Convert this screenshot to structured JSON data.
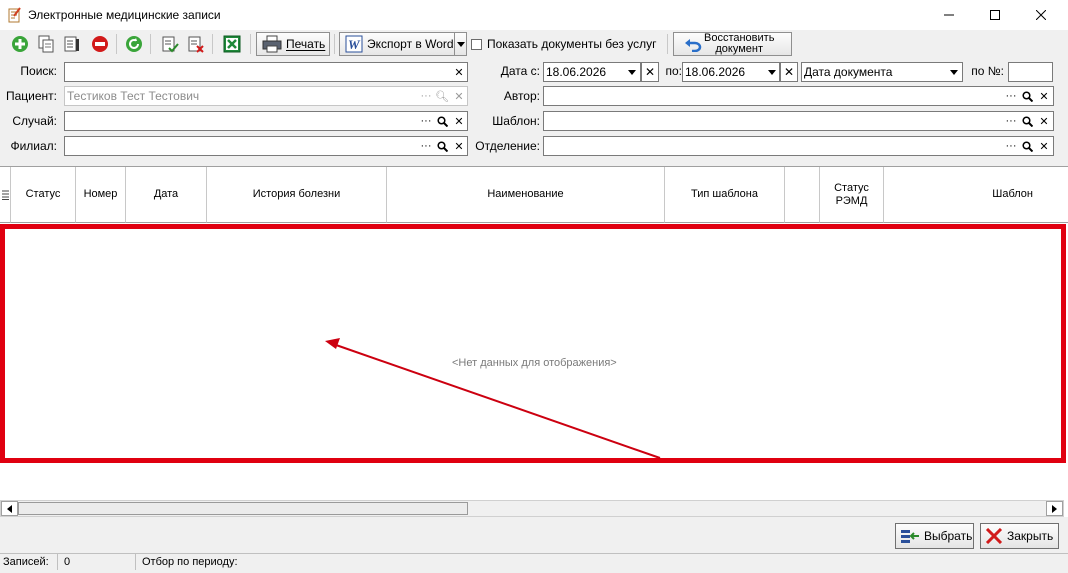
{
  "window": {
    "title": "Электронные медицинские записи",
    "minimize_glyph": "—",
    "maximize_glyph": "☐",
    "close_glyph": "✕"
  },
  "toolbar": {
    "print_label": "Печать",
    "export_label": "Экспорт в Word",
    "show_docs_label": "Показать документы без услуг",
    "show_docs_checked": false,
    "restore_label_line1": "Восстановить",
    "restore_label_line2": "документ",
    "icons": [
      "add-icon",
      "copy-icon",
      "edit-icon",
      "delete-icon",
      "refresh-icon",
      "sign-icon",
      "unsign-icon",
      "excel-icon",
      "printer-icon",
      "word-icon",
      "undo-arrow-icon"
    ]
  },
  "filters": {
    "search_label": "Поиск:",
    "search_value": "",
    "patient_label": "Пациент:",
    "patient_value": "Тестиков Тест Тестович",
    "case_label": "Случай:",
    "case_value": "",
    "branch_label": "Филиал:",
    "branch_value": "",
    "date_from_label": "Дата с:",
    "date_from_value": "18.06.2026",
    "date_to_label": "по:",
    "date_to_value": "18.06.2026",
    "date_type_value": "Дата документа",
    "number_label": "по №:",
    "number_value": "",
    "author_label": "Автор:",
    "author_value": "",
    "template_label": "Шаблон:",
    "template_value": "",
    "department_label": "Отделение:",
    "department_value": ""
  },
  "grid": {
    "columns": [
      "Статус",
      "Номер",
      "Дата",
      "История болезни",
      "Наименование",
      "Тип шаблона",
      "",
      "Статус РЭМД",
      "Шаблон"
    ],
    "empty_text": "<Нет данных для отображения>",
    "highlight_color": "#e00010"
  },
  "actions": {
    "select_label": "Выбрать",
    "close_label": "Закрыть"
  },
  "status": {
    "records_label": "Записей:",
    "records_value": "0",
    "period_label": "Отбор по периоду:",
    "period_value": ""
  }
}
